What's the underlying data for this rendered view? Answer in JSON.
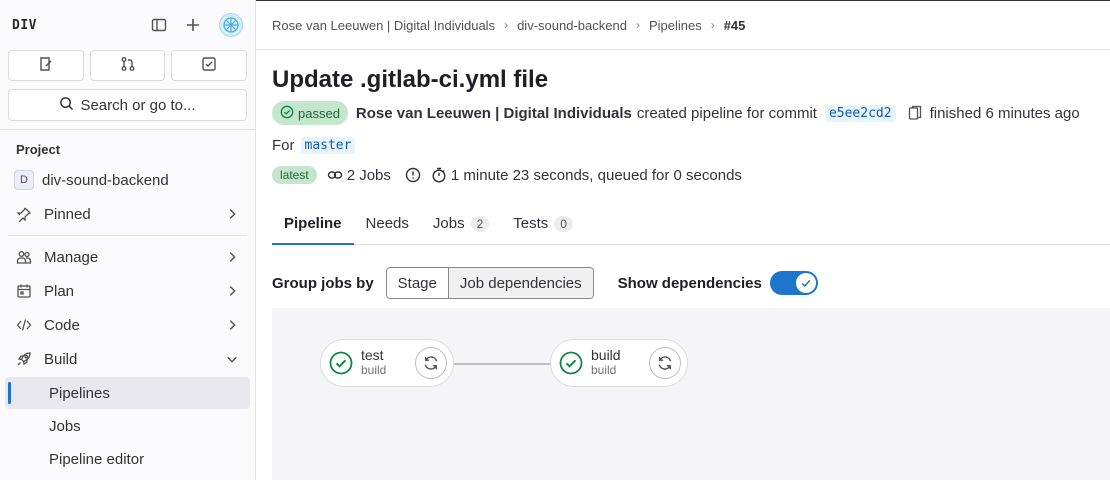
{
  "sidebar": {
    "logo": "DIV",
    "top_actions": [
      "sidebar-toggle-icon",
      "plus-icon",
      "avatar"
    ],
    "quick_buttons": [
      "issues-icon",
      "merge-requests-icon",
      "todo-icon"
    ],
    "search_label": "Search or go to...",
    "section_title": "Project",
    "project_badge": "D",
    "project_name": "div-sound-backend",
    "items": [
      {
        "label": "Pinned",
        "icon": "pin-icon"
      },
      {
        "label": "Manage",
        "icon": "users-icon"
      },
      {
        "label": "Plan",
        "icon": "calendar-icon"
      },
      {
        "label": "Code",
        "icon": "code-icon"
      },
      {
        "label": "Build",
        "icon": "rocket-icon"
      }
    ],
    "build_subitems": [
      "Pipelines",
      "Jobs",
      "Pipeline editor"
    ]
  },
  "breadcrumb": {
    "items": [
      "Rose van Leeuwen | Digital Individuals",
      "div-sound-backend",
      "Pipelines"
    ],
    "current": "#45"
  },
  "pipeline": {
    "title": "Update .gitlab-ci.yml file",
    "status": "passed",
    "author": "Rose van Leeuwen | Digital Individuals",
    "created_text": "created pipeline for commit",
    "commit_sha": "e5ee2cd2",
    "finished_text": "finished 6 minutes ago",
    "for_label": "For",
    "branch": "master",
    "latest_tag": "latest",
    "jobs_count_text": "2 Jobs",
    "duration_text": "1 minute 23 seconds, queued for 0 seconds"
  },
  "tabs": [
    {
      "label": "Pipeline",
      "count": ""
    },
    {
      "label": "Needs",
      "count": ""
    },
    {
      "label": "Jobs",
      "count": "2"
    },
    {
      "label": "Tests",
      "count": "0"
    }
  ],
  "controls": {
    "group_label": "Group jobs by",
    "group_options": [
      "Stage",
      "Job dependencies"
    ],
    "group_selected": "Job dependencies",
    "show_deps_label": "Show dependencies",
    "show_deps_on": true
  },
  "graph": {
    "jobs": [
      {
        "name": "test",
        "stage": "build",
        "status": "success"
      },
      {
        "name": "build",
        "stage": "build",
        "status": "success"
      }
    ]
  },
  "colors": {
    "accent": "#1f75cb",
    "success": "#108548",
    "success_bg": "#c3e6cd"
  }
}
